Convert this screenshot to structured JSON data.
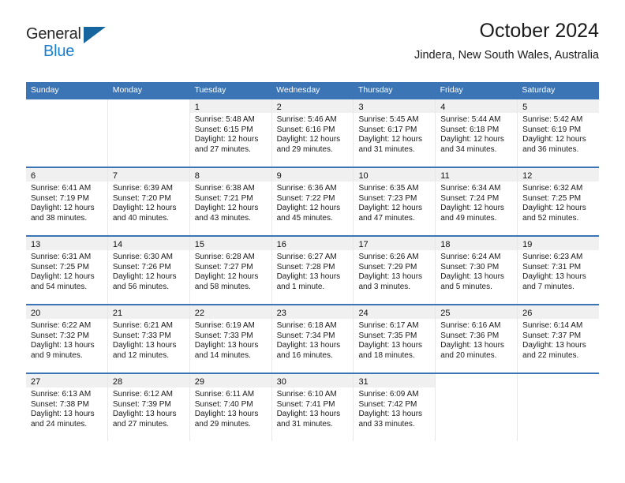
{
  "brand": {
    "name_part1": "General",
    "name_part2": "Blue",
    "triangle_color": "#17659f",
    "blue_text_color": "#1b7fd0"
  },
  "header": {
    "title": "October 2024",
    "subtitle": "Jindera, New South Wales, Australia"
  },
  "theme": {
    "header_blue": "#3b75b5",
    "daynum_band": "#f0f0f0",
    "cell_divider": "#e8e8e8"
  },
  "weekdays": [
    "Sunday",
    "Monday",
    "Tuesday",
    "Wednesday",
    "Thursday",
    "Friday",
    "Saturday"
  ],
  "weeks": [
    [
      {
        "day": "",
        "sunrise": "",
        "sunset": "",
        "daylight1": "",
        "daylight2": ""
      },
      {
        "day": "",
        "sunrise": "",
        "sunset": "",
        "daylight1": "",
        "daylight2": ""
      },
      {
        "day": "1",
        "sunrise": "Sunrise: 5:48 AM",
        "sunset": "Sunset: 6:15 PM",
        "daylight1": "Daylight: 12 hours",
        "daylight2": "and 27 minutes."
      },
      {
        "day": "2",
        "sunrise": "Sunrise: 5:46 AM",
        "sunset": "Sunset: 6:16 PM",
        "daylight1": "Daylight: 12 hours",
        "daylight2": "and 29 minutes."
      },
      {
        "day": "3",
        "sunrise": "Sunrise: 5:45 AM",
        "sunset": "Sunset: 6:17 PM",
        "daylight1": "Daylight: 12 hours",
        "daylight2": "and 31 minutes."
      },
      {
        "day": "4",
        "sunrise": "Sunrise: 5:44 AM",
        "sunset": "Sunset: 6:18 PM",
        "daylight1": "Daylight: 12 hours",
        "daylight2": "and 34 minutes."
      },
      {
        "day": "5",
        "sunrise": "Sunrise: 5:42 AM",
        "sunset": "Sunset: 6:19 PM",
        "daylight1": "Daylight: 12 hours",
        "daylight2": "and 36 minutes."
      }
    ],
    [
      {
        "day": "6",
        "sunrise": "Sunrise: 6:41 AM",
        "sunset": "Sunset: 7:19 PM",
        "daylight1": "Daylight: 12 hours",
        "daylight2": "and 38 minutes."
      },
      {
        "day": "7",
        "sunrise": "Sunrise: 6:39 AM",
        "sunset": "Sunset: 7:20 PM",
        "daylight1": "Daylight: 12 hours",
        "daylight2": "and 40 minutes."
      },
      {
        "day": "8",
        "sunrise": "Sunrise: 6:38 AM",
        "sunset": "Sunset: 7:21 PM",
        "daylight1": "Daylight: 12 hours",
        "daylight2": "and 43 minutes."
      },
      {
        "day": "9",
        "sunrise": "Sunrise: 6:36 AM",
        "sunset": "Sunset: 7:22 PM",
        "daylight1": "Daylight: 12 hours",
        "daylight2": "and 45 minutes."
      },
      {
        "day": "10",
        "sunrise": "Sunrise: 6:35 AM",
        "sunset": "Sunset: 7:23 PM",
        "daylight1": "Daylight: 12 hours",
        "daylight2": "and 47 minutes."
      },
      {
        "day": "11",
        "sunrise": "Sunrise: 6:34 AM",
        "sunset": "Sunset: 7:24 PM",
        "daylight1": "Daylight: 12 hours",
        "daylight2": "and 49 minutes."
      },
      {
        "day": "12",
        "sunrise": "Sunrise: 6:32 AM",
        "sunset": "Sunset: 7:25 PM",
        "daylight1": "Daylight: 12 hours",
        "daylight2": "and 52 minutes."
      }
    ],
    [
      {
        "day": "13",
        "sunrise": "Sunrise: 6:31 AM",
        "sunset": "Sunset: 7:25 PM",
        "daylight1": "Daylight: 12 hours",
        "daylight2": "and 54 minutes."
      },
      {
        "day": "14",
        "sunrise": "Sunrise: 6:30 AM",
        "sunset": "Sunset: 7:26 PM",
        "daylight1": "Daylight: 12 hours",
        "daylight2": "and 56 minutes."
      },
      {
        "day": "15",
        "sunrise": "Sunrise: 6:28 AM",
        "sunset": "Sunset: 7:27 PM",
        "daylight1": "Daylight: 12 hours",
        "daylight2": "and 58 minutes."
      },
      {
        "day": "16",
        "sunrise": "Sunrise: 6:27 AM",
        "sunset": "Sunset: 7:28 PM",
        "daylight1": "Daylight: 13 hours",
        "daylight2": "and 1 minute."
      },
      {
        "day": "17",
        "sunrise": "Sunrise: 6:26 AM",
        "sunset": "Sunset: 7:29 PM",
        "daylight1": "Daylight: 13 hours",
        "daylight2": "and 3 minutes."
      },
      {
        "day": "18",
        "sunrise": "Sunrise: 6:24 AM",
        "sunset": "Sunset: 7:30 PM",
        "daylight1": "Daylight: 13 hours",
        "daylight2": "and 5 minutes."
      },
      {
        "day": "19",
        "sunrise": "Sunrise: 6:23 AM",
        "sunset": "Sunset: 7:31 PM",
        "daylight1": "Daylight: 13 hours",
        "daylight2": "and 7 minutes."
      }
    ],
    [
      {
        "day": "20",
        "sunrise": "Sunrise: 6:22 AM",
        "sunset": "Sunset: 7:32 PM",
        "daylight1": "Daylight: 13 hours",
        "daylight2": "and 9 minutes."
      },
      {
        "day": "21",
        "sunrise": "Sunrise: 6:21 AM",
        "sunset": "Sunset: 7:33 PM",
        "daylight1": "Daylight: 13 hours",
        "daylight2": "and 12 minutes."
      },
      {
        "day": "22",
        "sunrise": "Sunrise: 6:19 AM",
        "sunset": "Sunset: 7:33 PM",
        "daylight1": "Daylight: 13 hours",
        "daylight2": "and 14 minutes."
      },
      {
        "day": "23",
        "sunrise": "Sunrise: 6:18 AM",
        "sunset": "Sunset: 7:34 PM",
        "daylight1": "Daylight: 13 hours",
        "daylight2": "and 16 minutes."
      },
      {
        "day": "24",
        "sunrise": "Sunrise: 6:17 AM",
        "sunset": "Sunset: 7:35 PM",
        "daylight1": "Daylight: 13 hours",
        "daylight2": "and 18 minutes."
      },
      {
        "day": "25",
        "sunrise": "Sunrise: 6:16 AM",
        "sunset": "Sunset: 7:36 PM",
        "daylight1": "Daylight: 13 hours",
        "daylight2": "and 20 minutes."
      },
      {
        "day": "26",
        "sunrise": "Sunrise: 6:14 AM",
        "sunset": "Sunset: 7:37 PM",
        "daylight1": "Daylight: 13 hours",
        "daylight2": "and 22 minutes."
      }
    ],
    [
      {
        "day": "27",
        "sunrise": "Sunrise: 6:13 AM",
        "sunset": "Sunset: 7:38 PM",
        "daylight1": "Daylight: 13 hours",
        "daylight2": "and 24 minutes."
      },
      {
        "day": "28",
        "sunrise": "Sunrise: 6:12 AM",
        "sunset": "Sunset: 7:39 PM",
        "daylight1": "Daylight: 13 hours",
        "daylight2": "and 27 minutes."
      },
      {
        "day": "29",
        "sunrise": "Sunrise: 6:11 AM",
        "sunset": "Sunset: 7:40 PM",
        "daylight1": "Daylight: 13 hours",
        "daylight2": "and 29 minutes."
      },
      {
        "day": "30",
        "sunrise": "Sunrise: 6:10 AM",
        "sunset": "Sunset: 7:41 PM",
        "daylight1": "Daylight: 13 hours",
        "daylight2": "and 31 minutes."
      },
      {
        "day": "31",
        "sunrise": "Sunrise: 6:09 AM",
        "sunset": "Sunset: 7:42 PM",
        "daylight1": "Daylight: 13 hours",
        "daylight2": "and 33 minutes."
      },
      {
        "day": "",
        "sunrise": "",
        "sunset": "",
        "daylight1": "",
        "daylight2": ""
      },
      {
        "day": "",
        "sunrise": "",
        "sunset": "",
        "daylight1": "",
        "daylight2": ""
      }
    ]
  ]
}
